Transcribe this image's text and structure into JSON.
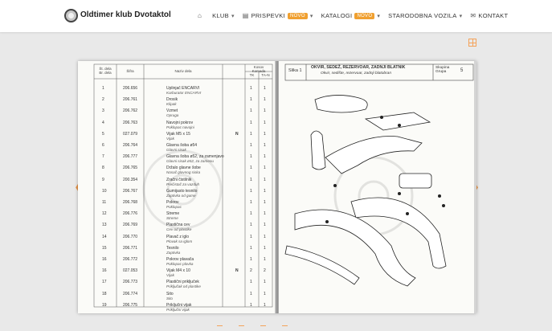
{
  "header": {
    "brand": "Oldtimer klub Dvotaktol",
    "nav": [
      {
        "label": "KLUB",
        "badge": "",
        "icon": "home-icon"
      },
      {
        "label": "PRISPEVKI",
        "badge": "NOVO",
        "icon": "newspaper-icon"
      },
      {
        "label": "KATALOGI",
        "badge": "NOVO",
        "icon": ""
      },
      {
        "label": "STARODOBNA VOZILA",
        "badge": "",
        "icon": ""
      },
      {
        "label": "KONTAKT",
        "badge": "",
        "icon": "envelope-icon"
      }
    ]
  },
  "colors": {
    "accent": "#f0a030",
    "arrow": "#e7964a"
  },
  "left_page": {
    "headers": {
      "num": "Št. dela\nBr. dela",
      "code": "Šifra",
      "name": "Naziv dela",
      "qty": "Kosov\nKomada",
      "tk": "TK",
      "tan": "TA-N"
    },
    "rows": [
      {
        "n": "1",
        "code": "206.656",
        "name": "Uplinjač ENCARVI",
        "sub": "Karburator ENCARVI",
        "m": "",
        "a": "1",
        "b": "1"
      },
      {
        "n": "2",
        "code": "206.761",
        "name": "Drosik",
        "sub": "Klipak",
        "m": "",
        "a": "1",
        "b": "1"
      },
      {
        "n": "3",
        "code": "206.762",
        "name": "Vzmet",
        "sub": "Opruga",
        "m": "",
        "a": "1",
        "b": "1"
      },
      {
        "n": "4",
        "code": "206.763",
        "name": "Navojni pokrov",
        "sub": "Poklopac navojni",
        "m": "",
        "a": "1",
        "b": "1"
      },
      {
        "n": "5",
        "code": "027.079",
        "name": "Vijak M5 x 15",
        "sub": "Vijak",
        "m": "N",
        "a": "1",
        "b": "1"
      },
      {
        "n": "6",
        "code": "206.764",
        "name": "Glavna šoba ø54",
        "sub": "Glavni sisak",
        "m": "",
        "a": "1",
        "b": "1"
      },
      {
        "n": "7",
        "code": "206.777",
        "name": "Glavna šoba ø52, za zamenjavo",
        "sub": "Glavni sisak ø52, za zamenu",
        "m": "",
        "a": "1",
        "b": "1"
      },
      {
        "n": "8",
        "code": "206.765",
        "name": "Držalo glavne šobe",
        "sub": "Nosač glavnog siska",
        "m": "",
        "a": "1",
        "b": "1"
      },
      {
        "n": "9",
        "code": "200.354",
        "name": "Zračni čistilnik",
        "sub": "Prečistač za vazduh",
        "m": "",
        "a": "1",
        "b": "1"
      },
      {
        "n": "10",
        "code": "206.767",
        "name": "Gumijasto tesnilo",
        "sub": "Zaptivka od gume",
        "m": "",
        "a": "1",
        "b": "1"
      },
      {
        "n": "11",
        "code": "206.768",
        "name": "Pokrov",
        "sub": "Poklopac",
        "m": "",
        "a": "1",
        "b": "1"
      },
      {
        "n": "12",
        "code": "206.776",
        "name": "Streme",
        "sub": "Streme",
        "m": "",
        "a": "1",
        "b": "1"
      },
      {
        "n": "13",
        "code": "206.769",
        "name": "Plastična cev",
        "sub": "Cev od plastike",
        "m": "",
        "a": "1",
        "b": "1"
      },
      {
        "n": "14",
        "code": "206.770",
        "name": "Plavač z iglo",
        "sub": "Plovak sa iglom",
        "m": "",
        "a": "1",
        "b": "1"
      },
      {
        "n": "15",
        "code": "206.771",
        "name": "Tesnilo",
        "sub": "Zaptivka",
        "m": "",
        "a": "1",
        "b": "1"
      },
      {
        "n": "16",
        "code": "206.772",
        "name": "Pokrov plavača",
        "sub": "Poklopac plovka",
        "m": "",
        "a": "1",
        "b": "1"
      },
      {
        "n": "16",
        "code": "027.053",
        "name": "Vijak M4 x 10",
        "sub": "Vijak",
        "m": "N",
        "a": "2",
        "b": "2"
      },
      {
        "n": "17",
        "code": "206.773",
        "name": "Plastični priključek",
        "sub": "Priključak od plastike",
        "m": "",
        "a": "1",
        "b": "1"
      },
      {
        "n": "18",
        "code": "206.774",
        "name": "Sito",
        "sub": "Sito",
        "m": "",
        "a": "1",
        "b": "1"
      },
      {
        "n": "19",
        "code": "206.775",
        "name": "Priključni vijak",
        "sub": "Priključni vijak",
        "m": "",
        "a": "1",
        "b": "1"
      }
    ]
  },
  "right_page": {
    "slika": "Slika 1",
    "title": "OKVIR, SEDEŽ, REZERVOAR, ZADNJI BLATNIK",
    "subtitle": "Okvir, sedište, rezervoar, zadnji blatobran",
    "skupina": "Skupina\nGrupa",
    "skupina_num": "5"
  }
}
